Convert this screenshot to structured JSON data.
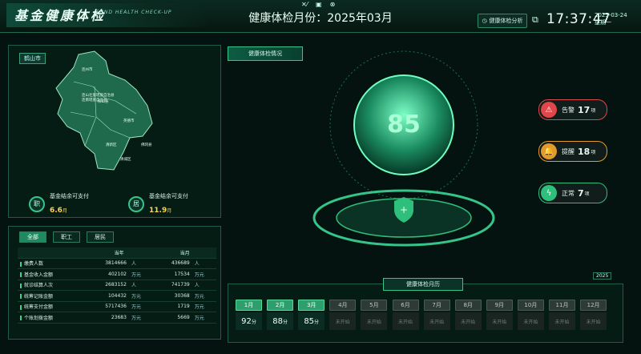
{
  "header": {
    "title_cn": "基金健康体检",
    "title_en": "FUND HEALTH CHECK-UP",
    "page_title": "健康体检月份：2025年03月",
    "analysis_button": "健康体检分析",
    "time": "17:37:47",
    "date": "2025-03-24",
    "weekday": "星期一"
  },
  "map": {
    "tag": "鹤山市",
    "regions": [
      "连州市",
      "清新区",
      "清远市",
      "英德市",
      "佛冈县",
      "阳山县",
      "清城区",
      "连山壮族瑶族自治县",
      "连南瑶族自治县"
    ],
    "stats": [
      {
        "icon": "职",
        "label": "基金结余可支付",
        "value": "6.6",
        "unit": "月"
      },
      {
        "icon": "居",
        "label": "基金结余可支付",
        "value": "11.9",
        "unit": "月"
      }
    ]
  },
  "tabs": [
    "全部",
    "职工",
    "居民"
  ],
  "table": {
    "headers": [
      "当年",
      "当月"
    ],
    "rows": [
      {
        "label": "缴费人数",
        "year": "3814666",
        "year_unit": "人",
        "month": "436689",
        "month_unit": "人"
      },
      {
        "label": "基金收入金额",
        "year": "402102",
        "year_unit": "万元",
        "month": "17534",
        "month_unit": "万元"
      },
      {
        "label": "就诊结算人次",
        "year": "2683152",
        "year_unit": "人",
        "month": "741739",
        "month_unit": "人"
      },
      {
        "label": "统筹记账金额",
        "year": "104432",
        "year_unit": "万元",
        "month": "30368",
        "month_unit": "万元"
      },
      {
        "label": "统筹支付金额",
        "year": "5717436",
        "year_unit": "万元",
        "month": "1719",
        "month_unit": "万元"
      },
      {
        "label": "个账划拨金额",
        "year": "23683",
        "year_unit": "万元",
        "month": "5669",
        "month_unit": "万元"
      }
    ]
  },
  "health": {
    "section_title": "健康体检情况",
    "score": "85",
    "alerts": [
      {
        "label": "告警",
        "count": "17",
        "unit": "项",
        "icon": "warning-icon",
        "color": "#e0464a"
      },
      {
        "label": "提醒",
        "count": "18",
        "unit": "项",
        "icon": "bell-icon",
        "color": "#e39a2c"
      },
      {
        "label": "正常",
        "count": "7",
        "unit": "项",
        "icon": "bolt-icon",
        "color": "#2fbf7c"
      }
    ]
  },
  "calendar": {
    "title": "健康体检月历",
    "year": "2025",
    "months": [
      {
        "name": "1月",
        "value": "92",
        "unit": "分",
        "done": true
      },
      {
        "name": "2月",
        "value": "88",
        "unit": "分",
        "done": true
      },
      {
        "name": "3月",
        "value": "85",
        "unit": "分",
        "done": true
      },
      {
        "name": "4月",
        "value": "未开始",
        "unit": "",
        "done": false
      },
      {
        "name": "5月",
        "value": "未开始",
        "unit": "",
        "done": false
      },
      {
        "name": "6月",
        "value": "未开始",
        "unit": "",
        "done": false
      },
      {
        "name": "7月",
        "value": "未开始",
        "unit": "",
        "done": false
      },
      {
        "name": "8月",
        "value": "未开始",
        "unit": "",
        "done": false
      },
      {
        "name": "9月",
        "value": "未开始",
        "unit": "",
        "done": false
      },
      {
        "name": "10月",
        "value": "未开始",
        "unit": "",
        "done": false
      },
      {
        "name": "11月",
        "value": "未开始",
        "unit": "",
        "done": false
      },
      {
        "name": "12月",
        "value": "未开始",
        "unit": "",
        "done": false
      }
    ]
  },
  "colors": {
    "accent": "#35c48a",
    "highlight": "#ffd24a",
    "background": "#04130f"
  }
}
